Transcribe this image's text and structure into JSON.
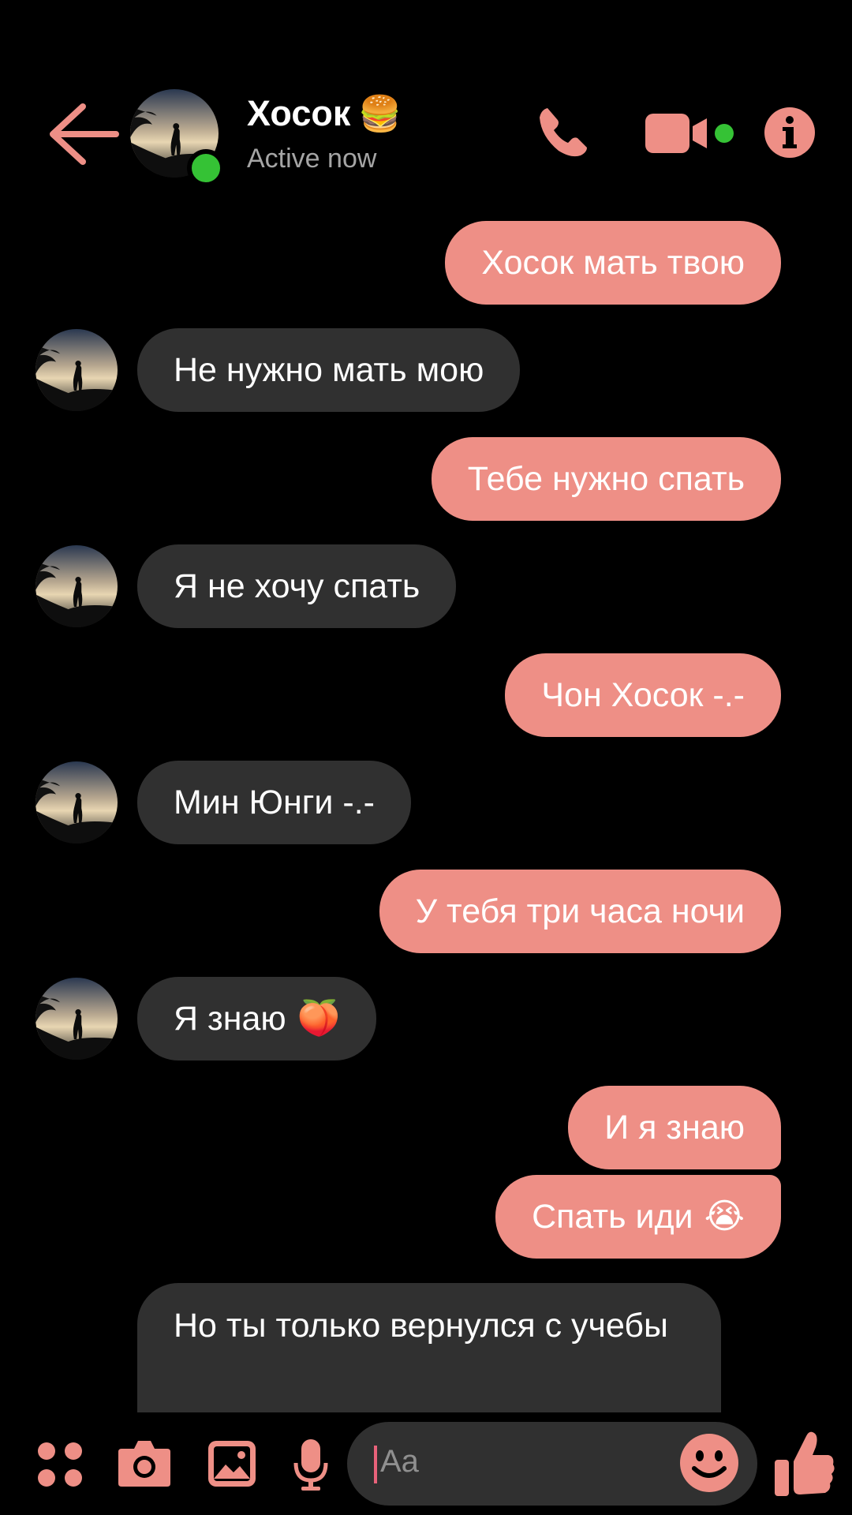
{
  "header": {
    "contact_name": "Хосок",
    "name_emoji": "🍔",
    "status": "Active now"
  },
  "messages": [
    {
      "side": "out",
      "text": "Хосок мать твою"
    },
    {
      "side": "in",
      "text": "Не нужно мать мою"
    },
    {
      "side": "out",
      "text": "Тебе нужно спать"
    },
    {
      "side": "in",
      "text": "Я не хочу спать"
    },
    {
      "side": "out",
      "text": "Чон Хосок -.-"
    },
    {
      "side": "in",
      "text": "Мин Юнги -.-"
    },
    {
      "side": "out",
      "text": "У тебя три часа ночи"
    },
    {
      "side": "in",
      "text": "Я знаю",
      "emoji": "🍑"
    },
    {
      "side": "out",
      "text": "И я знаю"
    },
    {
      "side": "out",
      "text": "Спать иди",
      "emoji": "😭"
    },
    {
      "side": "in",
      "text": "Но ты только вернулся с учебы"
    }
  ],
  "composer": {
    "placeholder": "Aa"
  },
  "colors": {
    "accent": "#ee8f86",
    "incoming_bubble": "#303030",
    "online": "#35c235"
  },
  "icons": [
    "back-arrow-icon",
    "phone-icon",
    "video-camera-icon",
    "info-icon",
    "apps-icon",
    "camera-icon",
    "gallery-icon",
    "microphone-icon",
    "smile-icon",
    "thumbs-up-icon"
  ]
}
